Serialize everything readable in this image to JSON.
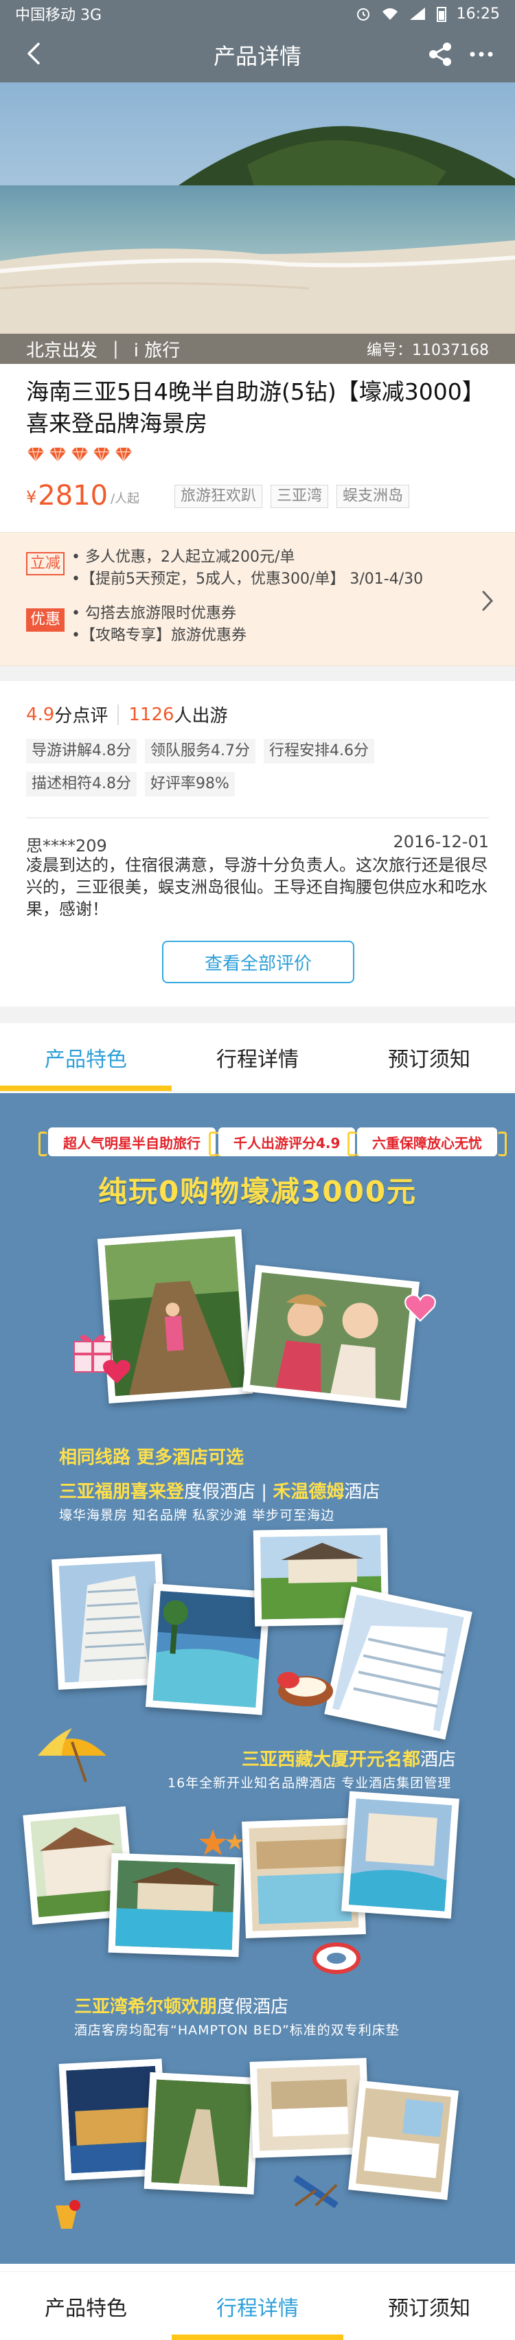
{
  "status": {
    "carrier": "中国移动 3G",
    "time": "16:25"
  },
  "nav": {
    "title": "产品详情"
  },
  "hero": {
    "departure": "北京出发",
    "brand": "i 旅行",
    "code": "编号：11037168"
  },
  "product": {
    "title": "海南三亚5日4晚半自助游(5钻)【壕减3000】喜来登品牌海景房",
    "diamond_count": 5,
    "price_symbol": "¥",
    "price": "2810",
    "price_unit": "/人起",
    "tags": [
      "旅游狂欢趴",
      "三亚湾",
      "蜈支洲岛"
    ]
  },
  "promo": {
    "badge1": "立减",
    "badge2": "优惠",
    "lines": [
      "• 多人优惠，2人起立减200元/单",
      "•【提前5天预定，5成人，优惠300/单】 3/01-4/30",
      "• 勾搭去旅游限时优惠券",
      "•【攻略专享】旅游优惠券"
    ]
  },
  "rating": {
    "score": "4.9",
    "score_label": "分点评",
    "count": "1126",
    "count_label": "人出游",
    "chips_row1": [
      "导游讲解4.8分",
      "领队服务4.7分",
      "行程安排4.6分"
    ],
    "chips_row2": [
      "描述相符4.8分",
      "好评率98%"
    ]
  },
  "review": {
    "user": "思****209",
    "date": "2016-12-01",
    "text": "凌晨到达的，住宿很满意，导游十分负责人。这次旅行还是很尽兴的，三亚很美，蜈支洲岛很仙。王导还自掏腰包供应水和吃水果，感谢！",
    "all_button": "查看全部评价"
  },
  "tabs": [
    "产品特色",
    "行程详情",
    "预订须知"
  ],
  "banner": {
    "pills": [
      "超人气明星半自助旅行",
      "千人出游评分4.9",
      "六重保障放心无忧"
    ],
    "headline": "纯玩0购物壕减3000元",
    "hotels_heading": "相同线路  更多酒店可选",
    "hotel1_title_a": "三亚福朋喜来登",
    "hotel1_title_b": "度假酒店",
    "hotel1_title_c": "禾温德姆",
    "hotel1_title_d": "酒店",
    "hotel1_sub": "壕华海景房 知名品牌 私家沙滩 举步可至海边",
    "hotel2_title_a": "三亚西藏大厦开元名都",
    "hotel2_title_b": "酒店",
    "hotel2_sub": "16年全新开业知名品牌酒店 专业酒店集团管理",
    "hotel3_title_a": "三亚湾希尔顿欢朋",
    "hotel3_title_b": "度假酒店",
    "hotel3_sub": "酒店客房均配有“HAMPTON BED”标准的双专利床垫"
  },
  "colors": {
    "accent": "#2d9fd8",
    "price": "#f15a2b",
    "highlight": "#ffc61a",
    "banner_bg": "#5c8ab3",
    "nav_bg": "#6a7781"
  }
}
